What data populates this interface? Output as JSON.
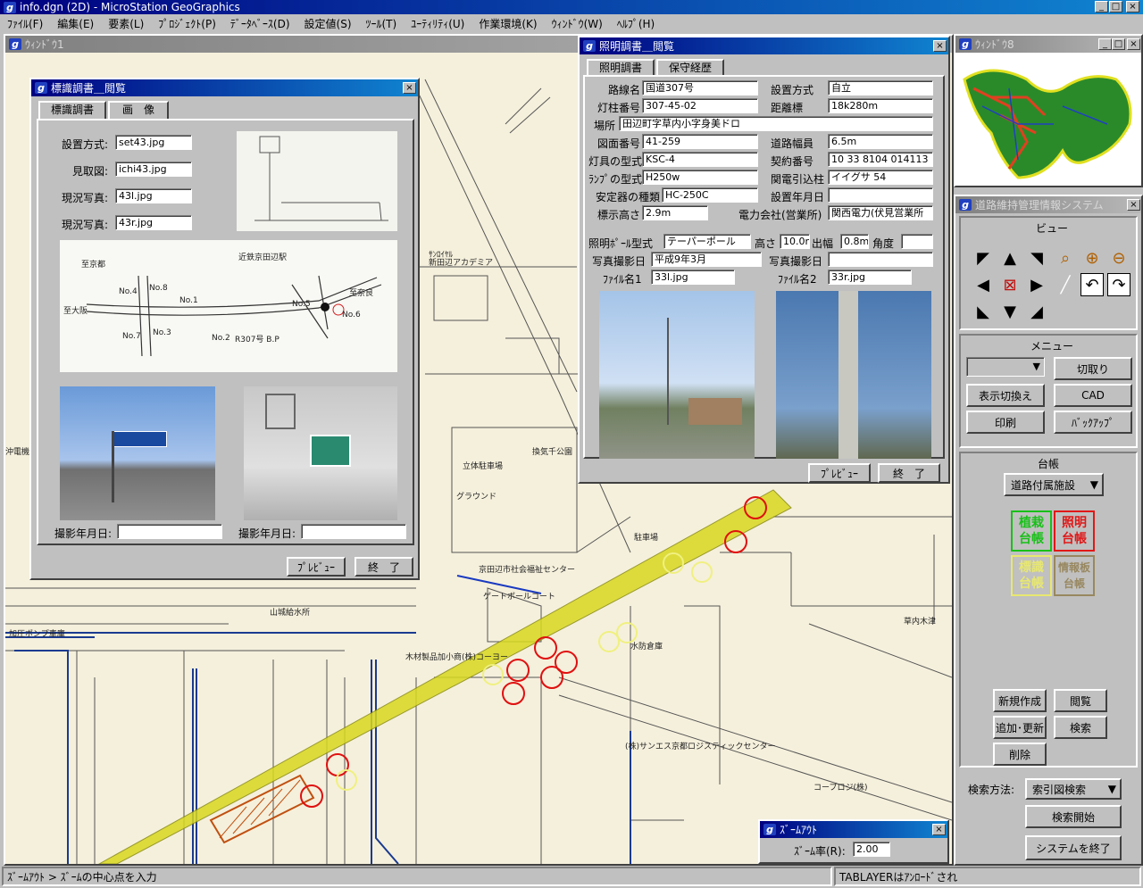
{
  "app": {
    "title": "info.dgn (2D) - MicroStation GeoGraphics"
  },
  "menu": [
    "ﾌｧｲﾙ(F)",
    "編集(E)",
    "要素(L)",
    "ﾌﾟﾛｼﾞｪｸﾄ(P)",
    "ﾃﾞｰﾀﾍﾞｰｽ(D)",
    "設定値(S)",
    "ﾂｰﾙ(T)",
    "ﾕｰﾃｨﾘﾃｨ(U)",
    "作業環境(K)",
    "ｳｨﾝﾄﾞｳ(W)",
    "ﾍﾙﾌﾟ(H)"
  ],
  "window1": {
    "title": "ｳｨﾝﾄﾞｳ1"
  },
  "window8": {
    "title": "ｳｨﾝﾄﾞｳ8"
  },
  "map_labels": {
    "l1": "ｻﾝﾛｲﾔﾙ",
    "l2": "新田辺アカデミア",
    "l3": "立体駐車場",
    "l4": "グラウンド",
    "l5": "換気千公園",
    "l6": "駐車場",
    "l7": "ゲートボールコート",
    "l8": "京田辺市社会福祉センター",
    "l9": "木材製品加小商(株)コーヨー",
    "l10": "水防倉庫",
    "l11": "(株)サンエス京都ロジスティックセンター",
    "l12": "草内木津",
    "l13": "山城給水所",
    "l14": "加圧ポンプ車庫",
    "l15": "コープロジ(株)",
    "l16": "沖電機"
  },
  "sign_dialog": {
    "title": "標識調書＿閲覧",
    "tabs": [
      "標識調書",
      "画　像"
    ],
    "fields": [
      {
        "label": "設置方式:",
        "value": "set43.jpg"
      },
      {
        "label": "見取図:",
        "value": "ichi43.jpg"
      },
      {
        "label": "現況写真:",
        "value": "43l.jpg"
      },
      {
        "label": "現況写真:",
        "value": "43r.jpg"
      }
    ],
    "sketch_labels": {
      "a": "No.4",
      "b": "No.8",
      "c": "No.1",
      "d": "No.5",
      "e": "No.6",
      "f": "No.3",
      "g": "No.2",
      "h": "No.7",
      "i": "R307号 B.P",
      "j": "近鉄京田辺駅",
      "k": "至大阪",
      "l": "至奈良",
      "m": "至京都"
    },
    "shoot1_label": "撮影年月日:",
    "shoot2_label": "撮影年月日:",
    "preview": "ﾌﾟﾚﾋﾞｭｰ",
    "exit": "終　了"
  },
  "light_dialog": {
    "title": "照明調書＿閲覧",
    "tabs": [
      "照明調書",
      "保守経歴"
    ],
    "rows": [
      [
        {
          "label": "路線名",
          "value": "国道307号"
        },
        {
          "label": "設置方式",
          "value": "自立"
        }
      ],
      [
        {
          "label": "灯柱番号",
          "value": "307-45-02"
        },
        {
          "label": "距離標",
          "value": "18k280m"
        }
      ],
      [
        {
          "label": "場所",
          "value": "田辺町字草内小字身美ドロ"
        }
      ],
      [
        {
          "label": "図面番号",
          "value": "41-259"
        },
        {
          "label": "道路幅員",
          "value": "6.5m"
        }
      ],
      [
        {
          "label": "灯具の型式",
          "value": "KSC-4"
        },
        {
          "label": "契約番号",
          "value": "10 33 8104 014113"
        }
      ],
      [
        {
          "label": "ﾗﾝﾌﾟの型式",
          "value": "H250w"
        },
        {
          "label": "関電引込柱",
          "value": "イイグサ 54"
        }
      ],
      [
        {
          "label": "安定器の種類",
          "value": "HC-250C"
        },
        {
          "label": "設置年月日",
          "value": ""
        }
      ],
      [
        {
          "label": "標示高さ",
          "value": "2.9m"
        },
        {
          "label": "電力会社(営業所)",
          "value": "関西電力(伏見営業所"
        }
      ]
    ],
    "row9": {
      "l1": "照明ﾎﾟｰﾙ型式",
      "v1": "テーパーポール",
      "l2": "高さ",
      "v2": "10.0m",
      "l3": "出幅",
      "v3": "0.8m",
      "l4": "角度",
      "v4": ""
    },
    "row10": {
      "l1": "写真撮影日",
      "v1": "平成9年3月",
      "l2": "写真撮影日",
      "v2": ""
    },
    "row11": {
      "l1": "ﾌｧｲﾙ名1",
      "v1": "33l.jpg",
      "l2": "ﾌｧｲﾙ名2",
      "v2": "33r.jpg"
    },
    "preview": "ﾌﾟﾚﾋﾞｭｰ",
    "exit": "終　了"
  },
  "panel": {
    "title": "道路維持管理情報システム",
    "view_label": "ビュー",
    "menu_label": "メニュー",
    "menu_buttons": [
      "切取り",
      "表示切換え",
      "CAD",
      "印刷",
      "ﾊﾞｯｸｱｯﾌﾟ"
    ],
    "ledger_label": "台帳",
    "ledger_select": "道路付属施設",
    "ledger_buttons": [
      {
        "t1": "植栽",
        "t2": "台帳",
        "color": "#18c018"
      },
      {
        "t1": "照明",
        "t2": "台帳",
        "color": "#e01818"
      },
      {
        "t1": "標識",
        "t2": "台帳",
        "color": "#e8e870"
      },
      {
        "t1": "情報板",
        "t2": "台帳",
        "color": "#988860"
      }
    ],
    "actions": [
      "新規作成",
      "閲覧",
      "追加･更新",
      "検索",
      "削除"
    ],
    "search_label": "検索方法:",
    "search_select": "索引図検索",
    "search_start": "検索開始",
    "exit": "システムを終了"
  },
  "zoom_dialog": {
    "title": "ｽﾞｰﾑｱｳﾄ",
    "label": "ｽﾞｰﾑ率(R):",
    "value": "2.00"
  },
  "status": {
    "left": "ｽﾞｰﾑｱｳﾄ > ｽﾞｰﾑの中心点を入力",
    "right": "TABLAYERはｱﾝﾛｰﾄﾞされ"
  }
}
